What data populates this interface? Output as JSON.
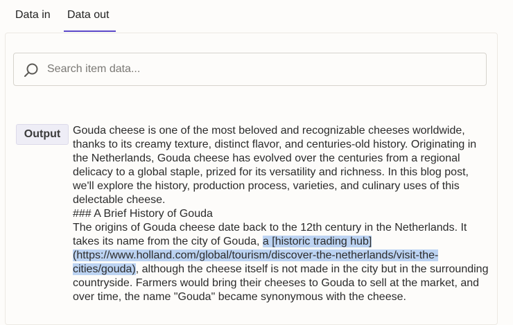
{
  "tabs": {
    "data_in": "Data in",
    "data_out": "Data out",
    "active": "Data out"
  },
  "search": {
    "placeholder": "Search item data...",
    "value": ""
  },
  "output": {
    "label": "Output",
    "text_before": "Gouda cheese is one of the most beloved and recognizable cheeses worldwide, thanks to its creamy texture, distinct flavor, and centuries-old history. Originating in the Netherlands, Gouda cheese has evolved over the centuries from a regional delicacy to a global staple, prized for its versatility and richness. In this blog post, we'll explore the history, production process, varieties, and culinary uses of this delectable cheese.\n### A Brief History of Gouda\nThe origins of Gouda cheese date back to the 12th century in the Netherlands. It takes its name from the city of Gouda, ",
    "text_selected": "a [historic trading hub](https://www.holland.com/global/tourism/discover-the-netherlands/visit-the-cities/gouda)",
    "text_after": ", although the cheese itself is not made in the city but in the surrounding countryside. Farmers would bring their cheeses to Gouda to sell at the market, and over time, the name \"Gouda\" became synonymous with the cheese."
  },
  "colors": {
    "accent": "#5a47c8",
    "selection": "#bcd3f2",
    "badge_bg": "#eeedf6"
  }
}
